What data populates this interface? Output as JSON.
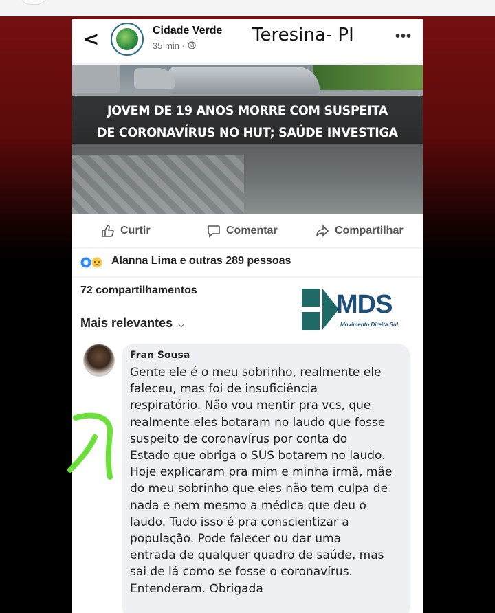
{
  "post": {
    "back_icon": "chevron-left-icon",
    "page_name": "Cidade Verde",
    "time": "35 min ·",
    "privacy_icon": "globe-icon",
    "location_overlay": "Teresina- PI",
    "more_icon": "more-horizontal-icon",
    "headline_line1": "JOVEM DE 19 ANOS MORRE COM SUSPEITA",
    "headline_line2": "DE CORONAVÍRUS NO HUT; SAÚDE INVESTIGA"
  },
  "actions": {
    "like": "Curtir",
    "comment": "Comentar",
    "share": "Compartilhar"
  },
  "reactions": {
    "icons": [
      "like-reaction-icon",
      "sad-reaction-icon"
    ],
    "text": "Alanna Lima e outras 289 pessoas"
  },
  "shares": {
    "count_text": "72 compartilhamentos",
    "sort_label": "Mais relevantes",
    "sort_icon": "chevron-down-icon"
  },
  "watermark": {
    "logo_text": "MDS",
    "logo_sub": "Movimento Direita Sul"
  },
  "comment": {
    "author": "Fran Sousa",
    "lines": [
      "Gente ele é o meu sobrinho, realmente ele",
      "faleceu, mas foi de insuficiência",
      "respiratório. Não vou mentir pra vcs, que",
      "realmente eles botaram no laudo que fosse",
      "suspeito de coronavírus por conta do",
      "Estado que obriga o SUS botarem no laudo.",
      "Hoje explicaram pra mim e minha irmã, mãe",
      "do meu sobrinho que eles não tem culpa de",
      "nada e nem mesmo a médica que deu o",
      "laudo. Tudo isso é pra conscientizar a",
      "população. Pode falecer ou dar uma",
      "entrada de qualquer quadro de saúde, mas",
      "sai de lá como se fosse o coronavírus.",
      "Entenderam. Obrigada"
    ]
  },
  "colors": {
    "annotation_mark": "#6be03a",
    "logo_teal": "#1f6a66",
    "logo_blue": "#1d4f7a"
  }
}
